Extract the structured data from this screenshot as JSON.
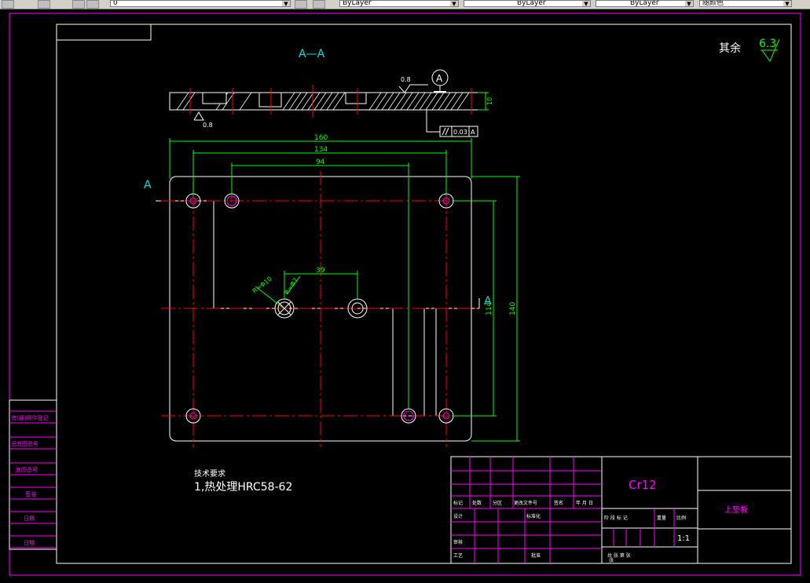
{
  "toolbar": {
    "layer_name": "0",
    "color": "ByLayer",
    "linetype": "ByLayer",
    "lineweight": "ByLayer",
    "plotstyle": "随颜色"
  },
  "drawing": {
    "section_label": "A—A",
    "roughness_rest_label": "其余",
    "roughness_rest_value": "6.3",
    "roughness_top": "0.8",
    "roughness_bottom": "0.8",
    "datum_label": "A",
    "parallel_tolerance": "0.03",
    "parallel_datum": "A",
    "thickness_dim": "10",
    "dim_160": "160",
    "dim_134": "134",
    "dim_94": "94",
    "dim_39": "39",
    "dim_140": "140",
    "dim_114": "114",
    "dim_r10": "R=Φ10",
    "dim_r7": "R=Φ7",
    "cut_label_left": "A",
    "cut_label_right": "A",
    "tech_req_title": "技术要求",
    "tech_req_item": "1,热处理HRC58-62"
  },
  "side_table": [
    "借(通)用件登记",
    "旧底图总号",
    "底图总号",
    "签名",
    "日期",
    "日期"
  ],
  "title_block": {
    "material": "Cr12",
    "part_name": "上垫板",
    "scale": "1:1",
    "row_headers": [
      "标记",
      "处数",
      "分区",
      "更改文件号",
      "签名",
      "年 月 日"
    ],
    "left_rows": [
      "设计",
      "审核",
      "工艺"
    ],
    "mid_rows": [
      "标准化",
      "批准"
    ],
    "stage_headers": [
      "阶 段 标 记",
      "重量",
      "比例"
    ],
    "sheet_info": "共  张  第  张",
    "sheet_info2": "张"
  },
  "colors": {
    "background": "#000000",
    "frame": "#ff00ff",
    "geometry": "#ffffff",
    "center": "#ff0000",
    "dimension": "#00ff00",
    "text": "#00ffff",
    "title_text": "#ff00ff",
    "cyan": "#00e0e0"
  }
}
